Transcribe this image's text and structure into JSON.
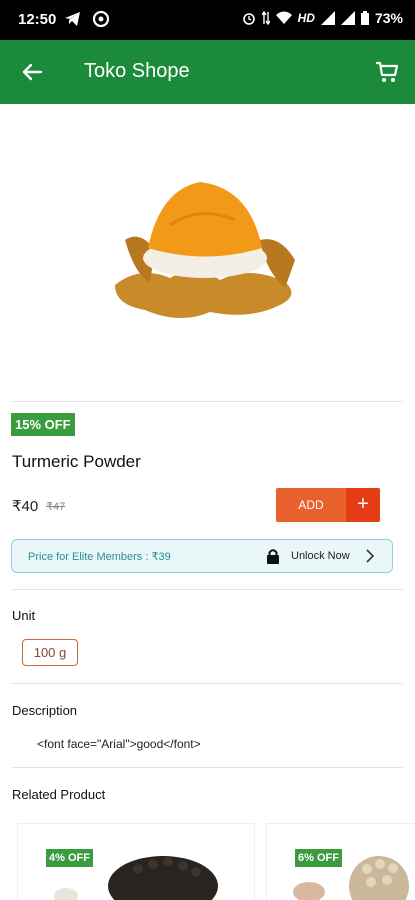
{
  "status_bar": {
    "time": "12:50",
    "network": "HD",
    "battery": "73%"
  },
  "app_bar": {
    "title": "Toko Shope"
  },
  "product": {
    "discount_badge": "15% OFF",
    "name": "Turmeric Powder",
    "price": "₹40",
    "mrp": "₹47",
    "add_label": "ADD",
    "add_plus": "+"
  },
  "elite": {
    "text": "Price for Elite Members : ₹39",
    "unlock_label": "Unlock Now"
  },
  "unit": {
    "title": "Unit",
    "options": [
      "100 g"
    ],
    "selected": "100 g"
  },
  "description": {
    "title": "Description",
    "text": "<font face=\"Arial\">good</font>"
  },
  "related": {
    "title": "Related Product",
    "items": [
      {
        "badge": "4% OFF"
      },
      {
        "badge": "6% OFF"
      }
    ]
  },
  "colors": {
    "app_bar": "#1b8a3a",
    "badge": "#3a9b3f",
    "add_button": "#e8602c",
    "add_plus": "#e43d16",
    "elite_bg": "#e9f7f8"
  }
}
